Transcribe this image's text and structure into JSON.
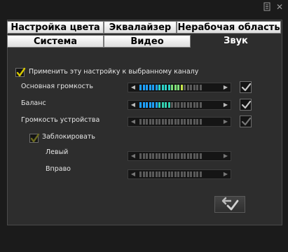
{
  "titlebar": {
    "icons": [
      "document-icon",
      "close-icon"
    ],
    "close_glyph": "✕"
  },
  "tabs_row1": [
    {
      "label": "Настройка цвета"
    },
    {
      "label": "Эквалайзер"
    },
    {
      "label": "Нерабочая область"
    }
  ],
  "tabs_row2": [
    {
      "label": "Система"
    },
    {
      "label": "Видео"
    },
    {
      "label": "Звук",
      "active": true
    }
  ],
  "apply_to_channel": {
    "label": "Применить эту настройку к выбранному каналу",
    "checked": true
  },
  "rows": [
    {
      "label": "Основная громкость",
      "fill_segments": 14,
      "total_segments": 20,
      "style": "rainbow",
      "checked": true
    },
    {
      "label": "Баланс",
      "fill_segments": 10,
      "total_segments": 20,
      "style": "blue-green",
      "checked": true
    },
    {
      "label": "Громкость устройства",
      "fill_segments": 0,
      "total_segments": 20,
      "style": "none",
      "checked": true,
      "disabled": true
    }
  ],
  "lock": {
    "label": "Заблокировать",
    "checked": true,
    "disabled": true
  },
  "channels": [
    {
      "label": "Левый",
      "fill_segments": 0,
      "total_segments": 20
    },
    {
      "label": "Вправо",
      "fill_segments": 0,
      "total_segments": 20
    }
  ],
  "colors": {
    "accent_check": "#d6c800",
    "window_bg": "#2d2d2d",
    "tab_active_bg": "#2d2d2d"
  }
}
